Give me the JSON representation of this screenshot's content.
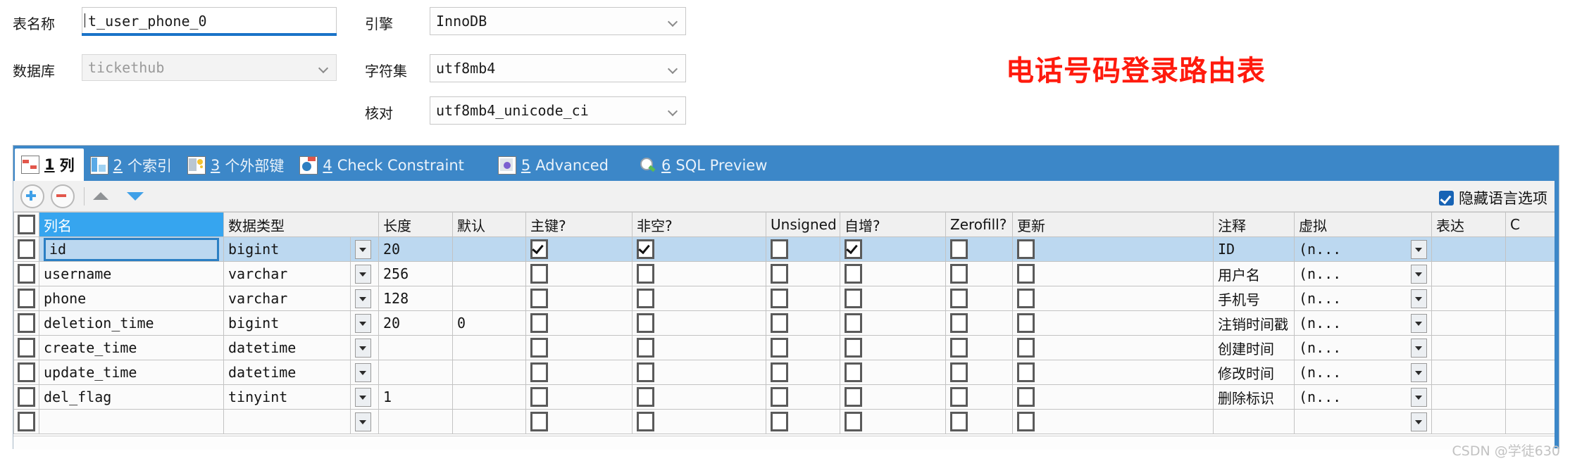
{
  "form": {
    "table_name_label": "表名称",
    "table_name_value": "t_user_phone_0",
    "database_label": "数据库",
    "database_value": "tickethub",
    "engine_label": "引擎",
    "engine_value": "InnoDB",
    "charset_label": "字符集",
    "charset_value": "utf8mb4",
    "collation_label": "核对",
    "collation_value": "utf8mb4_unicode_ci"
  },
  "annotation": {
    "text": "电话号码登录路由表",
    "color": "#ff1a0d"
  },
  "tabs": [
    {
      "num": "1",
      "label": "列",
      "icon": "columns-grid-icon",
      "active": true
    },
    {
      "num": "2",
      "label": "个索引",
      "icon": "index-icon",
      "active": false
    },
    {
      "num": "3",
      "label": "个外部键",
      "icon": "foreign-key-icon",
      "active": false
    },
    {
      "num": "4",
      "label": "Check Constraint",
      "icon": "check-constraint-icon",
      "active": false
    },
    {
      "num": "5",
      "label": "Advanced",
      "icon": "advanced-gear-icon",
      "active": false
    },
    {
      "num": "6",
      "label": "SQL Preview",
      "icon": "sql-preview-magnifier-icon",
      "active": false
    }
  ],
  "toolbar": {
    "add_title": "添加栏位",
    "remove_title": "删除栏位",
    "move_up_title": "上移",
    "move_down_title": "下移",
    "hide_lang_label": "隐藏语言选项",
    "hide_lang_checked": true
  },
  "grid": {
    "headers": [
      "列名",
      "数据类型",
      "长度",
      "默认",
      "主键?",
      "非空?",
      "Unsigned",
      "自增?",
      "Zerofill?",
      "更新",
      "注释",
      "虚拟",
      "表达",
      "C"
    ],
    "virtual_value": "(n...",
    "rows": [
      {
        "selected": true,
        "row_check": false,
        "name": "id",
        "type": "bigint",
        "length": "20",
        "default": "",
        "pk": true,
        "notnull": true,
        "unsigned": false,
        "autoinc": true,
        "zerofill": false,
        "update": false,
        "comment": "ID",
        "virtual": "(n...",
        "expression": ""
      },
      {
        "selected": false,
        "row_check": false,
        "name": "username",
        "type": "varchar",
        "length": "256",
        "default": "",
        "pk": false,
        "notnull": false,
        "unsigned": false,
        "autoinc": false,
        "zerofill": false,
        "update": false,
        "comment": "用户名",
        "virtual": "(n...",
        "expression": ""
      },
      {
        "selected": false,
        "row_check": false,
        "name": "phone",
        "type": "varchar",
        "length": "128",
        "default": "",
        "pk": false,
        "notnull": false,
        "unsigned": false,
        "autoinc": false,
        "zerofill": false,
        "update": false,
        "comment": "手机号",
        "virtual": "(n...",
        "expression": ""
      },
      {
        "selected": false,
        "row_check": false,
        "name": "deletion_time",
        "type": "bigint",
        "length": "20",
        "default": "0",
        "pk": false,
        "notnull": false,
        "unsigned": false,
        "autoinc": false,
        "zerofill": false,
        "update": false,
        "comment": "注销时间戳",
        "virtual": "(n...",
        "expression": ""
      },
      {
        "selected": false,
        "row_check": false,
        "name": "create_time",
        "type": "datetime",
        "length": "",
        "default": "",
        "pk": false,
        "notnull": false,
        "unsigned": false,
        "autoinc": false,
        "zerofill": false,
        "update": false,
        "comment": "创建时间",
        "virtual": "(n...",
        "expression": ""
      },
      {
        "selected": false,
        "row_check": false,
        "name": "update_time",
        "type": "datetime",
        "length": "",
        "default": "",
        "pk": false,
        "notnull": false,
        "unsigned": false,
        "autoinc": false,
        "zerofill": false,
        "update": false,
        "comment": "修改时间",
        "virtual": "(n...",
        "expression": ""
      },
      {
        "selected": false,
        "row_check": false,
        "name": "del_flag",
        "type": "tinyint",
        "length": "1",
        "default": "",
        "pk": false,
        "notnull": false,
        "unsigned": false,
        "autoinc": false,
        "zerofill": false,
        "update": false,
        "comment": "删除标识",
        "virtual": "(n...",
        "expression": ""
      },
      {
        "selected": false,
        "row_check": false,
        "name": "",
        "type": "",
        "length": "",
        "default": "",
        "pk": false,
        "notnull": false,
        "unsigned": false,
        "autoinc": false,
        "zerofill": false,
        "update": false,
        "comment": "",
        "virtual": "",
        "expression": ""
      }
    ]
  },
  "watermark": "CSDN @学徒630"
}
